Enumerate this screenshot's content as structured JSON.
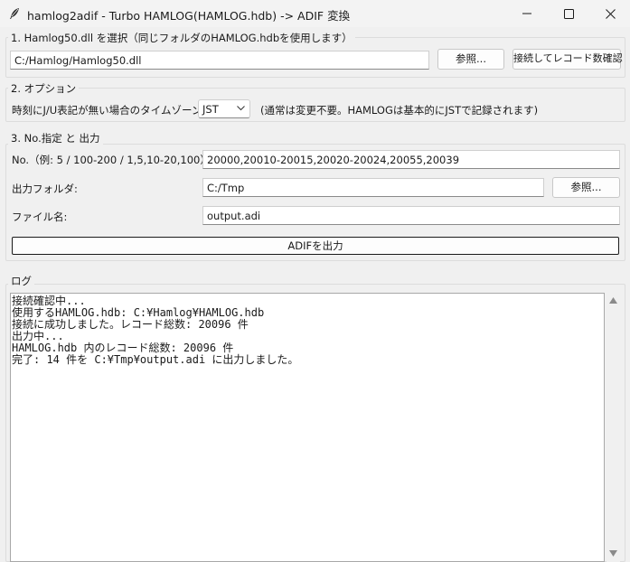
{
  "window": {
    "title": "hamlog2adif - Turbo HAMLOG(HAMLOG.hdb) -> ADIF 変換",
    "icon": "feather-icon"
  },
  "section1": {
    "legend": "1. Hamlog50.dll を選択（同じフォルダのHAMLOG.hdbを使用します）",
    "dll_path": "C:/Hamlog/Hamlog50.dll",
    "browse_label": "参照...",
    "connect_label": "接続してレコード数確認"
  },
  "section2": {
    "legend": "2. オプション",
    "tz_label": "時刻にJ/U表記が無い場合のタイムゾーン:",
    "tz_value": "JST",
    "tz_note": "(通常は変更不要。HAMLOGは基本的にJSTで記録されます)"
  },
  "section3": {
    "legend": "3. No.指定 と 出力",
    "no_label": "No.（例: 5 / 100-200 / 1,5,10-20,100）:",
    "no_value": "20000,20010-20015,20020-20024,20055,20039",
    "folder_label": "出力フォルダ:",
    "folder_value": "C:/Tmp",
    "folder_browse_label": "参照...",
    "filename_label": "ファイル名:",
    "filename_value": "output.adi",
    "export_label": "ADIFを出力"
  },
  "log": {
    "legend": "ログ",
    "lines": [
      "接続確認中...",
      "使用するHAMLOG.hdb: C:¥Hamlog¥HAMLOG.hdb",
      "接続に成功しました。レコード総数: 20096 件",
      "出力中...",
      "HAMLOG.hdb 内のレコード総数: 20096 件",
      "完了: 14 件を C:¥Tmp¥output.adi に出力しました。"
    ]
  }
}
